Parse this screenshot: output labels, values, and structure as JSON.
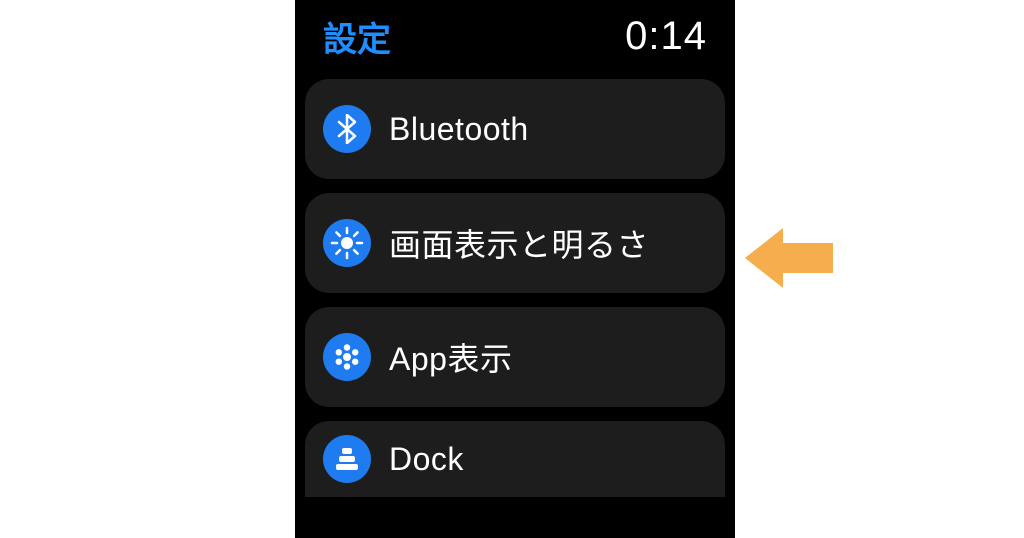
{
  "header": {
    "title": "設定",
    "time": "0:14"
  },
  "items": [
    {
      "icon": "bluetooth",
      "label": "Bluetooth"
    },
    {
      "icon": "brightness",
      "label": "画面表示と明るさ"
    },
    {
      "icon": "app-grid",
      "label": "App表示"
    },
    {
      "icon": "dock",
      "label": "Dock"
    }
  ],
  "colors": {
    "accent": "#1f8fff",
    "icon_bg": "#1f7cf0",
    "row_bg": "#1d1d1d",
    "arrow": "#f5ad4d"
  }
}
